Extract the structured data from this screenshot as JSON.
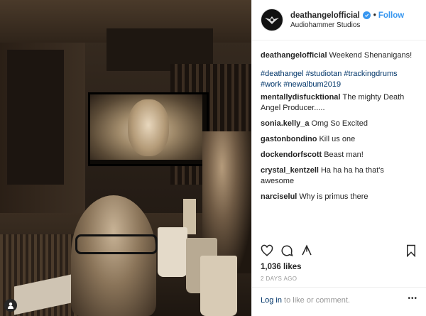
{
  "post": {
    "username": "deathangelofficial",
    "separator": "•",
    "follow_label": "Follow",
    "location": "Audiohammer Studios",
    "caption_user": "deathangelofficial",
    "caption_text": "Weekend Shenanigans!",
    "hashtags_line1": "#deathangel #studiotan #trackingdrums",
    "hashtags_line2": "#work #newalbum2019",
    "comments": [
      {
        "user": "mentallydisfucktional",
        "text": "The mighty Death Angel Producer....."
      },
      {
        "user": "sonia.kelly_a",
        "text": "Omg So Excited"
      },
      {
        "user": "gastonbondino",
        "text": "Kill us one"
      },
      {
        "user": "dockendorfscott",
        "text": "Beast man!"
      },
      {
        "user": "crystal_kentzell",
        "text": "Ha ha ha ha that's awesome"
      },
      {
        "user": "narciselul",
        "text": "Why is primus there"
      }
    ],
    "likes": "1,036 likes",
    "time_ago": "2 DAYS AGO",
    "login_link": "Log in",
    "login_text": " to like or comment.",
    "more_label": "•••"
  },
  "icons": {
    "verified": "verified-badge-icon",
    "like": "heart-icon",
    "comment": "comment-bubble-icon",
    "share": "share-icon",
    "save": "bookmark-icon",
    "tagged": "tagged-user-icon"
  },
  "colors": {
    "accent": "#3897f0",
    "link": "#003569",
    "muted": "#999999",
    "text": "#262626"
  }
}
